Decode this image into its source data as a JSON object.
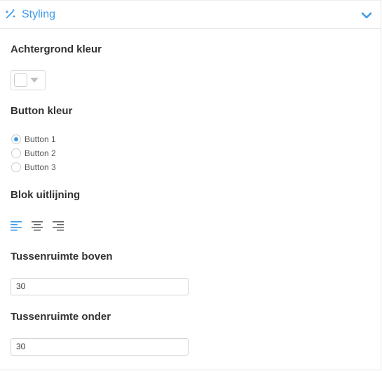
{
  "section": {
    "title": "Styling",
    "accent_color": "#3d9ae8",
    "icon": "magic-wand-icon",
    "toggle_icon": "chevron-down-icon"
  },
  "background": {
    "label": "Achtergrond kleur",
    "value_color": "#ffffff"
  },
  "button_color": {
    "label": "Button kleur",
    "options": [
      "Button 1",
      "Button 2",
      "Button 3"
    ],
    "selected": "Button 1"
  },
  "alignment": {
    "label": "Blok uitlijning",
    "options": [
      "align-left-icon",
      "align-center-icon",
      "align-right-icon"
    ],
    "selected": "align-left-icon"
  },
  "spacing_top": {
    "label": "Tussenruimte boven",
    "value": "30"
  },
  "spacing_bottom": {
    "label": "Tussenruimte onder",
    "value": "30"
  }
}
